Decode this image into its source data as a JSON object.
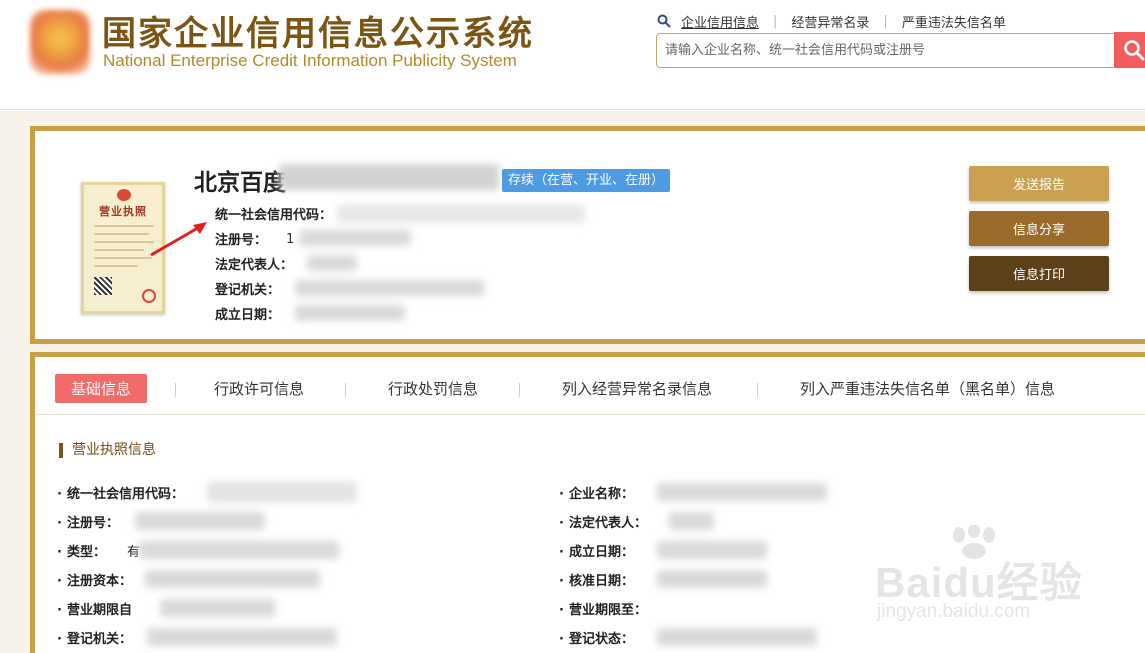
{
  "header": {
    "title": "国家企业信用信息公示系统",
    "subtitle": "National Enterprise Credit Information Publicity System",
    "nav": [
      "企业信用信息",
      "经营异常名录",
      "严重违法失信名单"
    ],
    "search_placeholder": "请输入企业名称、统一社会信用代码或注册号"
  },
  "company": {
    "name_visible": "北京百度",
    "status": "存续（在营、开业、在册）",
    "license_title": "营业执照",
    "fields": [
      {
        "label": "统一社会信用代码："
      },
      {
        "label": "注册号：",
        "prefix": "1"
      },
      {
        "label": "法定代表人："
      },
      {
        "label": "登记机关："
      },
      {
        "label": "成立日期："
      }
    ]
  },
  "actions": {
    "send_report": "发送报告",
    "share": "信息分享",
    "print": "信息打印"
  },
  "tabs": [
    "基础信息",
    "行政许可信息",
    "行政处罚信息",
    "列入经营异常名录信息",
    "列入严重违法失信名单（黑名单）信息"
  ],
  "license_section": {
    "title": "营业执照信息",
    "left_fields": [
      "统一社会信用代码：",
      "注册号：",
      "类型：",
      "注册资本：",
      "营业期限自",
      "登记机关："
    ],
    "type_prefix": "有",
    "right_fields": [
      "企业名称：",
      "法定代表人：",
      "成立日期：",
      "核准日期：",
      "营业期限至：",
      "登记状态："
    ]
  },
  "watermark": {
    "text": "Baidu经验",
    "sub": "jingyan.baidu.com"
  },
  "colors": {
    "gold_border": "#c8a045",
    "title_brown": "#7a5514",
    "btn_report": "#c9a050",
    "btn_share": "#9a6c2a",
    "btn_print": "#5c4118",
    "badge_blue": "#4c9be3",
    "tab_active": "#f26b6b",
    "search_red": "#f25c5c"
  }
}
